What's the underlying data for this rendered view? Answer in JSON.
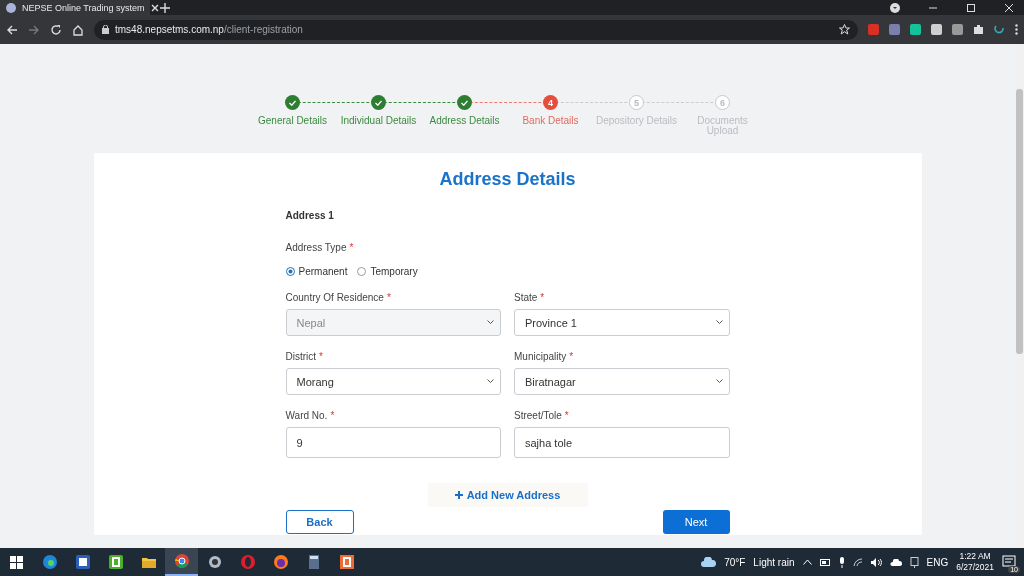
{
  "browser": {
    "tab_title": "NEPSE Online Trading system",
    "url_host": "tms48.nepsetms.com.np",
    "url_path": "/client-registration"
  },
  "steps": [
    {
      "label": "General Details",
      "done": true,
      "selected": false
    },
    {
      "label": "Individual Details",
      "done": true,
      "selected": false
    },
    {
      "label": "Address Details",
      "done": true,
      "selected": false
    },
    {
      "number": "4",
      "label": "Bank Details",
      "done": false,
      "selected": true
    },
    {
      "number": "5",
      "label": "Depository Details",
      "done": false,
      "selected": false
    },
    {
      "number": "6",
      "label": "Documents Upload",
      "done": false,
      "selected": false
    }
  ],
  "form": {
    "title": "Address Details",
    "section": "Address 1",
    "address_type": {
      "label": "Address Type",
      "required_mark": "*",
      "options": [
        {
          "label": "Permanent",
          "selected": true
        },
        {
          "label": "Temporary",
          "selected": false
        }
      ]
    },
    "fields": [
      {
        "label": "Country Of Residence",
        "required_mark": "*",
        "kind": "select",
        "value": "Nepal",
        "disabled": true
      },
      {
        "label": "State",
        "required_mark": "*",
        "kind": "select",
        "value": "Province 1",
        "disabled": false
      },
      {
        "label": "District",
        "required_mark": "*",
        "kind": "select",
        "value": "Morang",
        "disabled": false
      },
      {
        "label": "Municipality",
        "required_mark": "*",
        "kind": "select",
        "value": "Biratnagar",
        "disabled": false
      },
      {
        "label": "Ward No.",
        "required_mark": "*",
        "kind": "input",
        "value": "9",
        "disabled": false
      },
      {
        "label": "Street/Tole",
        "required_mark": "*",
        "kind": "input",
        "value": "sajha tole",
        "disabled": false
      }
    ],
    "add_button": "Add New Address",
    "back_button": "Back",
    "next_button": "Next"
  },
  "taskbar": {
    "apps": [
      {
        "kind": "edge",
        "selected": false
      },
      {
        "kind": "word",
        "selected": false
      },
      {
        "kind": "camtasia",
        "selected": false
      },
      {
        "kind": "folder",
        "selected": false
      },
      {
        "kind": "chrome",
        "selected": true
      },
      {
        "kind": "webcam",
        "selected": false
      },
      {
        "kind": "opera",
        "selected": false
      },
      {
        "kind": "firefox",
        "selected": false
      },
      {
        "kind": "calculator",
        "selected": false
      },
      {
        "kind": "recorder",
        "selected": false
      }
    ],
    "temperature": "70°F",
    "weather": "Light rain",
    "language": "ENG",
    "time": "1:22 AM",
    "date": "6/27/2021",
    "notifications": "10"
  }
}
